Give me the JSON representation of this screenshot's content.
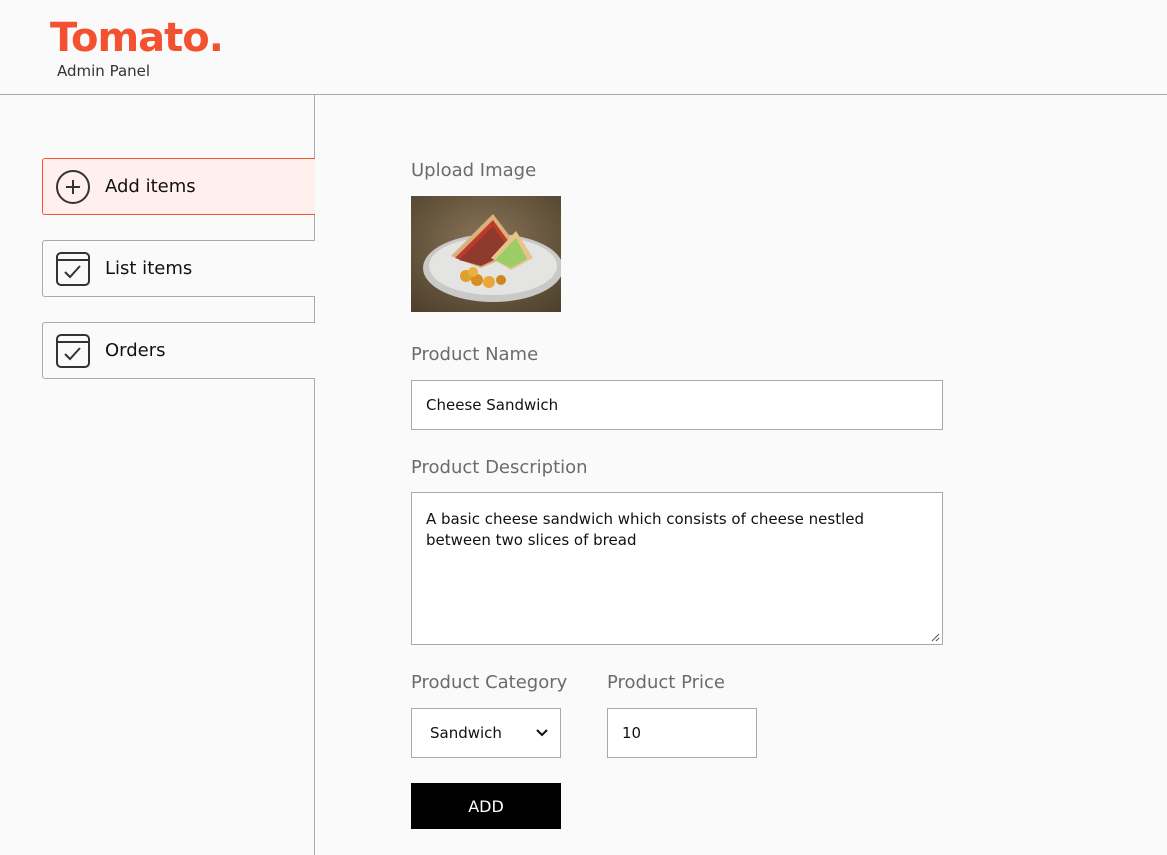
{
  "brand": {
    "name": "Tomato.",
    "subtitle": "Admin Panel",
    "accent_color": "#f35230"
  },
  "sidebar": {
    "items": [
      {
        "label": "Add items",
        "icon": "add-circle-icon",
        "active": true
      },
      {
        "label": "List items",
        "icon": "checklist-icon",
        "active": false
      },
      {
        "label": "Orders",
        "icon": "checklist-icon",
        "active": false
      }
    ]
  },
  "form": {
    "upload_label": "Upload Image",
    "name_label": "Product Name",
    "name_value": "Cheese Sandwich",
    "description_label": "Product Description",
    "description_value": "A basic cheese sandwich which consists of cheese nestled between two slices of bread",
    "category_label": "Product Category",
    "category_value": "Sandwich",
    "price_label": "Product Price",
    "price_value": "10",
    "submit_label": "ADD"
  }
}
